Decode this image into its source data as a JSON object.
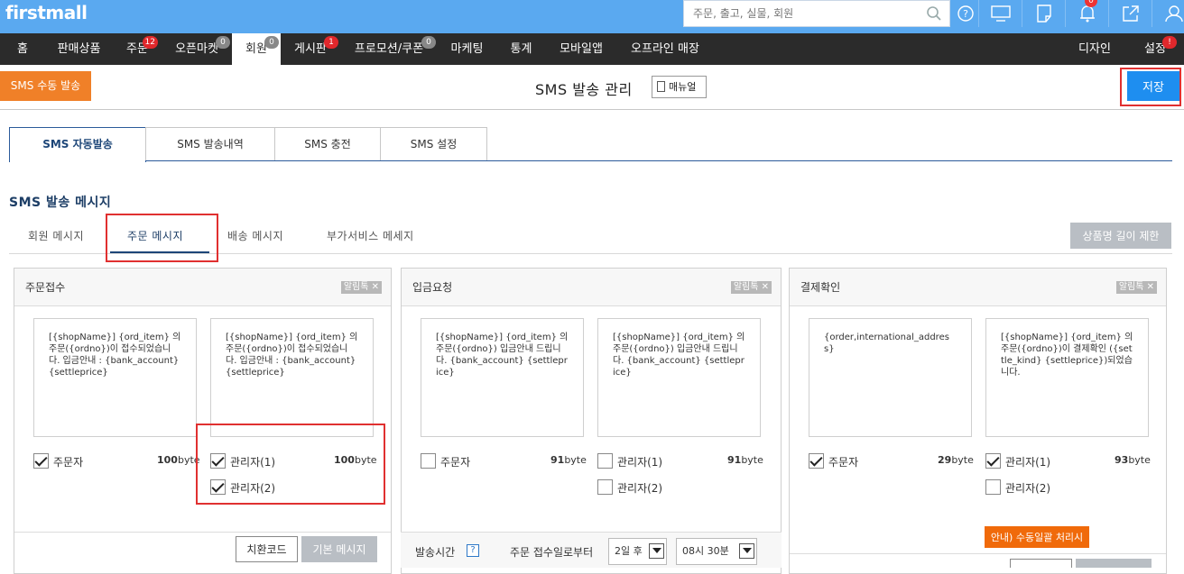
{
  "topbar": {
    "logo": "firstmall",
    "search_placeholder": "주문, 출고, 실물, 회원",
    "icons": [
      "help-icon",
      "monitor-icon",
      "memo-icon",
      "bell-icon",
      "external-link-icon",
      "user-icon"
    ],
    "bell_badge": "0"
  },
  "nav": {
    "items": [
      {
        "label": "홈",
        "badge": ""
      },
      {
        "label": "판매상품",
        "badge": ""
      },
      {
        "label": "주문",
        "badge": "12"
      },
      {
        "label": "오픈마켓",
        "badge": "0"
      },
      {
        "label": "회원",
        "badge": "0"
      },
      {
        "label": "게시판",
        "badge": "1"
      },
      {
        "label": "프로모션/쿠폰",
        "badge": "0"
      },
      {
        "label": "마케팅",
        "badge": ""
      },
      {
        "label": "통계",
        "badge": ""
      },
      {
        "label": "모바일앱",
        "badge": ""
      },
      {
        "label": "오프라인 매장",
        "badge": ""
      }
    ],
    "right": [
      {
        "label": "디자인",
        "badge": ""
      },
      {
        "label": "설정",
        "badge": "!"
      }
    ]
  },
  "header": {
    "sms_manual_button": "SMS 수동 발송",
    "title": "SMS 발송 관리",
    "manual_button": "매뉴얼",
    "save_button": "저장"
  },
  "main_tabs": [
    "SMS 자동발송",
    "SMS 발송내역",
    "SMS 충전",
    "SMS 설정"
  ],
  "section": {
    "title": "SMS 발송 메시지",
    "sub_tabs": [
      "회원 메시지",
      "주문 메시지",
      "배송 메시지",
      "부가서비스 메세지"
    ],
    "limit_button": "상품명 길이 제한"
  },
  "panels": [
    {
      "title": "주문접수",
      "alimtok": "알림톡 ✕",
      "messages": [
        "[{shopName}] {ord_item} 의 주문({ordno})이 접수되었습니다. 입금안내 : {bank_account} {settleprice}",
        "[{shopName}] {ord_item} 의 주문({ordno})이 접수되었습니다. 입금안내 : {bank_account} {settleprice}"
      ],
      "orderer_label": "주문자",
      "orderer_bytes": "100",
      "admin1_label": "관리자(1)",
      "admin1_bytes": "100",
      "admin2_label": "관리자(2)",
      "code_button": "치환코드",
      "default_button": "기본 메시지"
    },
    {
      "title": "입금요청",
      "alimtok": "알림톡 ✕",
      "messages": [
        "[{shopName}] {ord_item} 의 주문({ordno}) 입금안내 드립니다. {bank_account} {settleprice}",
        "[{shopName}] {ord_item} 의 주문({ordno}) 입금안내 드립니다. {bank_account} {settleprice}"
      ],
      "orderer_label": "주문자",
      "orderer_bytes": "91",
      "admin1_label": "관리자(1)",
      "admin1_bytes": "91",
      "admin2_label": "관리자(2)",
      "send_time_label": "발송시간",
      "help_mark": "?",
      "from_order_label": "주문 접수일로부터",
      "days_value": "2일 후",
      "time_value": "08시 30분"
    },
    {
      "title": "결제확인",
      "alimtok": "알림톡 ✕",
      "messages": [
        "{order,international_address}",
        "[{shopName}] {ord_item} 의 주문({ordno})이 결제확인 ({settle_kind}   {settleprice})되었습니다."
      ],
      "orderer_label": "주문자",
      "orderer_bytes": "29",
      "admin1_label": "관리자(1)",
      "admin1_bytes": "93",
      "admin2_label": "관리자(2)",
      "batch_button": "안내) 수동일괄 처리시"
    }
  ],
  "byte_unit": "byte",
  "colors": {
    "topbar": "#5aa9f0",
    "nav": "#2b2b2b",
    "orange": "#f08028",
    "save_blue": "#1e8ef0",
    "highlight_red": "#e03030",
    "navy": "#1d4678"
  }
}
